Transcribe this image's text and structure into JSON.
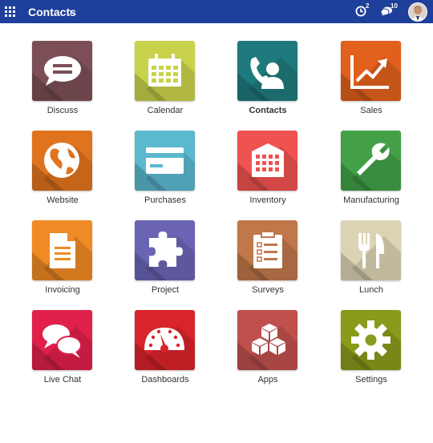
{
  "header": {
    "apps_menu_icon": "grid-icon",
    "brand": "Contacts",
    "breadcrumb_chevron": "›",
    "activities_icon": "clock-icon",
    "activities_count": "2",
    "messages_icon": "chat-icon",
    "messages_count": "10",
    "bar_color": "#1e3f9a"
  },
  "apps": [
    {
      "label": "Discuss",
      "icon": "chat-bubble-icon",
      "color": "#7b4f55"
    },
    {
      "label": "Calendar",
      "icon": "calendar-icon",
      "color": "#c9d24b"
    },
    {
      "label": "Contacts",
      "icon": "contacts-icon",
      "color": "#1f7a7d",
      "active": true
    },
    {
      "label": "Sales",
      "icon": "sales-chart-icon",
      "color": "#e0601c"
    },
    {
      "label": "Website",
      "icon": "globe-icon",
      "color": "#e0731e"
    },
    {
      "label": "Purchases",
      "icon": "credit-card-icon",
      "color": "#5ab8cf"
    },
    {
      "label": "Inventory",
      "icon": "warehouse-icon",
      "color": "#ef5350"
    },
    {
      "label": "Manufacturing",
      "icon": "wrench-icon",
      "color": "#43a047"
    },
    {
      "label": "Invoicing",
      "icon": "document-icon",
      "color": "#f08a24"
    },
    {
      "label": "Project",
      "icon": "puzzle-icon",
      "color": "#6b64b4"
    },
    {
      "label": "Surveys",
      "icon": "clipboard-icon",
      "color": "#c0774a"
    },
    {
      "label": "Lunch",
      "icon": "fork-knife-icon",
      "color": "#dcd3b4"
    },
    {
      "label": "Live Chat",
      "icon": "chat-bubbles-icon",
      "color": "#e0204b"
    },
    {
      "label": "Dashboards",
      "icon": "gauge-icon",
      "color": "#d9242b"
    },
    {
      "label": "Apps",
      "icon": "cubes-icon",
      "color": "#c0504d"
    },
    {
      "label": "Settings",
      "icon": "gear-icon",
      "color": "#8a9a1a"
    }
  ]
}
